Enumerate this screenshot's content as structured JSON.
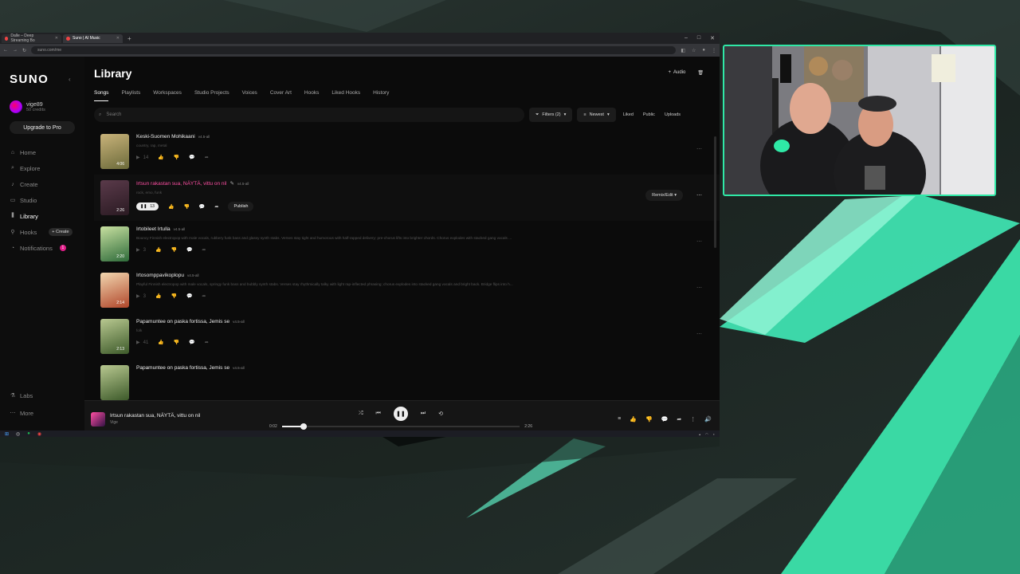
{
  "browser": {
    "tabs": [
      {
        "label": "Dalle – Deep Streaming Bo",
        "active": false
      },
      {
        "label": "Suno | AI Music",
        "active": true
      }
    ],
    "url": "suno.com/me"
  },
  "sidebar": {
    "logo": "SUNO",
    "user": {
      "name": "vige89",
      "credits": "50 credits"
    },
    "upgrade_label": "Upgrade to Pro",
    "items": [
      {
        "label": "Home",
        "icon": "home-icon",
        "active": false
      },
      {
        "label": "Explore",
        "icon": "explore-icon",
        "active": false
      },
      {
        "label": "Create",
        "icon": "create-icon",
        "active": false
      },
      {
        "label": "Studio",
        "icon": "studio-icon",
        "active": false
      },
      {
        "label": "Library",
        "icon": "library-icon",
        "active": true
      },
      {
        "label": "Hooks",
        "icon": "hooks-icon",
        "active": false,
        "badge": "+ Create"
      },
      {
        "label": "Notifications",
        "icon": "bell-icon",
        "active": false,
        "badge": "1"
      }
    ],
    "bottom": [
      {
        "label": "Labs",
        "icon": "labs-icon"
      },
      {
        "label": "More",
        "icon": "more-icon"
      }
    ]
  },
  "main": {
    "title": "Library",
    "audio_button": "Audio",
    "tabs": [
      "Songs",
      "Playlists",
      "Workspaces",
      "Studio Projects",
      "Voices",
      "Cover Art",
      "Hooks",
      "Liked Hooks",
      "History"
    ],
    "search_placeholder": "Search",
    "filters_label": "Filters (2)",
    "sort_label": "Newest",
    "quick_filters": [
      "Liked",
      "Public",
      "Uploads"
    ],
    "songs": [
      {
        "title": "Keski-Suomen Mohikaani",
        "version": "v4.5-all",
        "desc": "country, rap, metal",
        "duration": "4:06",
        "plays": "14",
        "colors": [
          "#6b6a3a",
          "#c9b37a"
        ],
        "playing": false
      },
      {
        "title": "Irtsun rakastan sua, NÄYTÄ, vittu on nil",
        "version": "v4.5-all",
        "desc": "rock, emo, funk",
        "duration": "2:26",
        "plays": "13",
        "colors": [
          "#2a1a22",
          "#5a3a4a"
        ],
        "playing": true,
        "publish_label": "Publish",
        "remix_label": "Remix/Edit"
      },
      {
        "title": "Irtobileet Irtulla",
        "version": "v4.5-all",
        "desc": "Bouncy Finnish electropop with male vocals, rubbery funk bass and glassy synth stabs. Verses stay tight and humorous with half-rapped delivery; pre-chorus lifts into brighter chords. Chorus explodes with stacked gang vocals ...",
        "duration": "2:20",
        "plays": "3",
        "colors": [
          "#2e6b3a",
          "#c8e0a0"
        ],
        "playing": false
      },
      {
        "title": "Irtosomppavikoplopu",
        "version": "v4.5-all",
        "desc": "Playful Finnish electropop with male vocals, springy funk bass and bubbly synth stabs. Verses stay rhythmically talky with light rap-inflected phrasing; chorus explodes into stacked gang vocals and bright back. Bridge flips into h...",
        "duration": "2:14",
        "plays": "3",
        "colors": [
          "#b0462a",
          "#f2d7b0"
        ],
        "playing": false
      },
      {
        "title": "Papamuntee on paska fortissa, Jemis se",
        "version": "v4.5-all",
        "desc": "folk",
        "duration": "2:13",
        "plays": "41",
        "colors": [
          "#3d5a2a",
          "#b8c890"
        ],
        "playing": false
      },
      {
        "title": "Papamuntee on paska fortissa, Jemis se",
        "version": "v4.5-all",
        "desc": "",
        "duration": "",
        "plays": "",
        "colors": [
          "#3d5a2a",
          "#b8c890"
        ],
        "playing": false
      }
    ]
  },
  "player": {
    "title": "Irtsun rakastan sua, NÄYTÄ, vittu on nil",
    "artist": "Vige",
    "elapsed": "0:02",
    "total": "2:26",
    "progress": 0.09
  },
  "colors": {
    "accent": "#ff4fa3",
    "cam_border": "#2fe8a6"
  }
}
